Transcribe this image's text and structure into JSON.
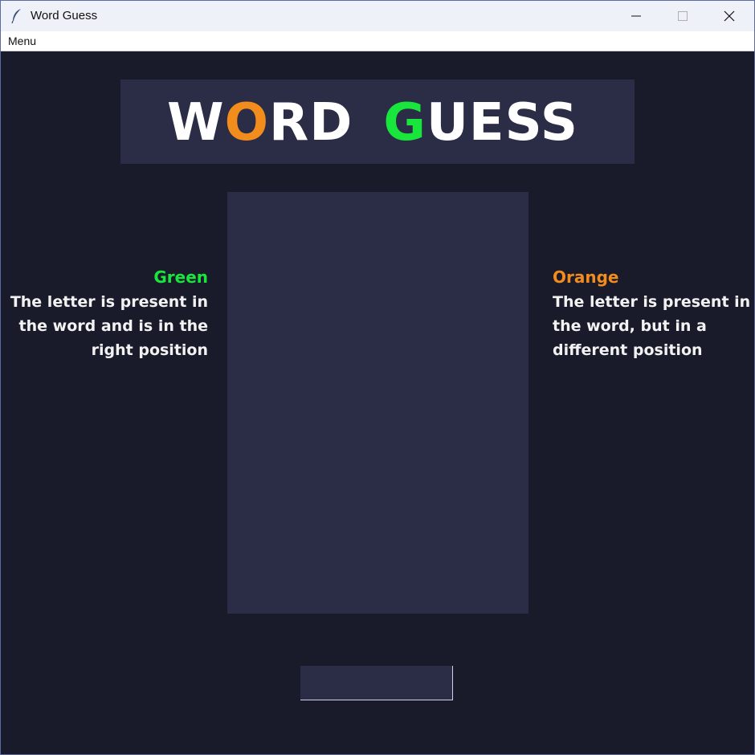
{
  "window": {
    "title": "Word Guess",
    "icon": "feather-icon"
  },
  "menubar": {
    "items": [
      "Menu"
    ]
  },
  "banner": {
    "word1": [
      "W",
      "O",
      "R",
      "D"
    ],
    "word2": [
      "G",
      "U",
      "E",
      "S",
      "S"
    ]
  },
  "legend": {
    "green": {
      "title": "Green",
      "lines": [
        "The letter is present in",
        "the word and is in the",
        "right position"
      ]
    },
    "orange": {
      "title": "Orange",
      "lines": [
        "The letter is present in",
        "the word, but in a",
        "different position"
      ]
    }
  },
  "input": {
    "value": "",
    "placeholder": ""
  },
  "colors": {
    "background": "#1a1b2a",
    "panel": "#2b2c45",
    "green": "#19e63c",
    "orange": "#f28c1c"
  }
}
